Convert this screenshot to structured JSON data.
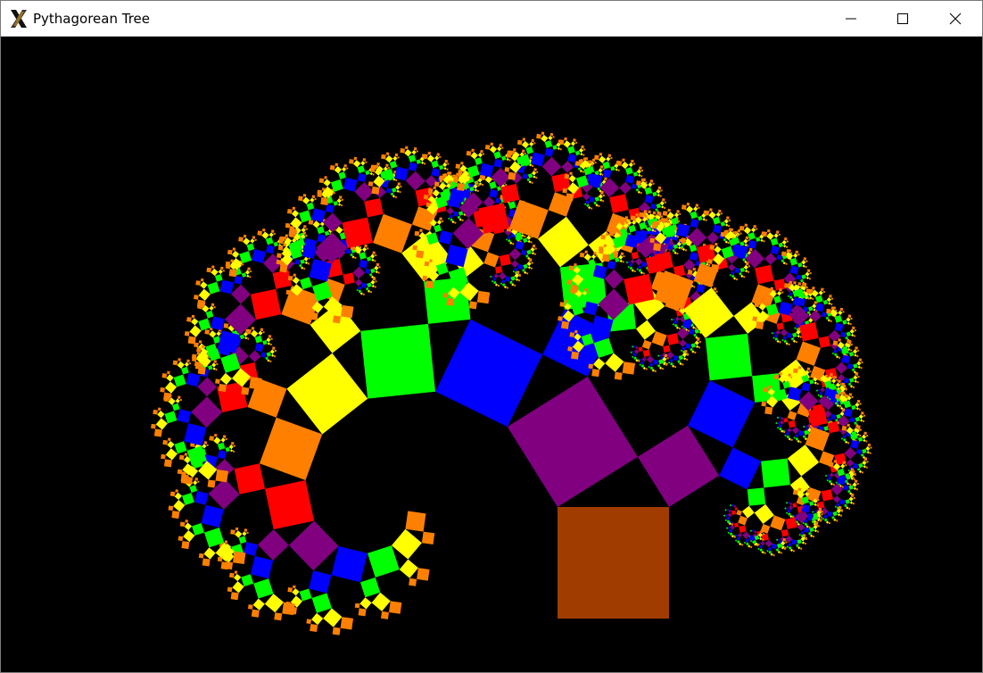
{
  "window": {
    "title": "Pythagorean Tree",
    "app_icon": "x-logo-icon",
    "controls": [
      "minimize-icon",
      "maximize-icon",
      "close-icon"
    ]
  },
  "fractal": {
    "depth": 11,
    "trunk_color": "#a03c00",
    "level_colors": [
      "#800080",
      "#0000ff",
      "#00ff00",
      "#ffff00",
      "#ff8000",
      "#ff0000"
    ],
    "background": "#000000"
  }
}
